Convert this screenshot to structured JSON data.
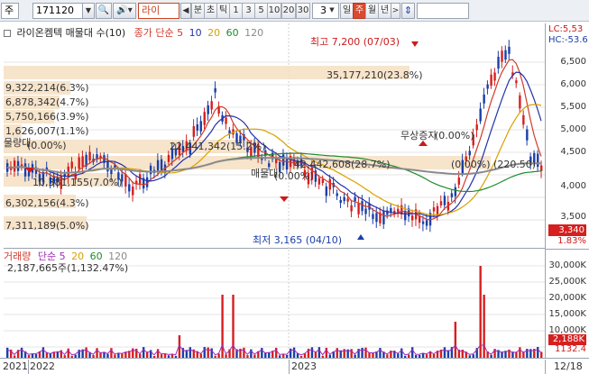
{
  "toolbar": {
    "market_code": "주",
    "stock_code": "171120",
    "stock_name": "라이",
    "period_tabs": [
      "분",
      "초",
      "틱",
      "1",
      "3",
      "5",
      "10",
      "20",
      "30"
    ],
    "period_value": "3",
    "range_tabs": [
      "일",
      "주",
      "월",
      "년"
    ],
    "active_range": "주"
  },
  "panel": {
    "title": "라이온켐텍 매물대 수(10)",
    "ma_label": "종가 단순",
    "ma_periods": [
      "5",
      "10",
      "20",
      "60",
      "120"
    ],
    "ma_colors": [
      "#d03b2c",
      "#2233aa",
      "#d9a100",
      "#1f8c2e",
      "#8a8a8a"
    ],
    "high_label": "최고 7,200 (07/03)",
    "low_label": "최저 3,165 (04/10)",
    "lc_label": "LC:5,53",
    "hc_label": "HC:-53.6",
    "current_price": "3,340",
    "change_pct": "1.83%"
  },
  "profile_labels": {
    "l1": "9,322,214(6.3%)",
    "l2": "6,878,342(4.7%)",
    "l3": "5,750,166(3.9%)",
    "l4": "1,626,007(1.1%)",
    "l5": "22,441,342(15.2%)",
    "l6": "35,177,210(23.8%)",
    "l7": "42,442,608(28.7%)",
    "l8": "6,302,156(4.3%)",
    "l9": "7,311,189(5.0%)",
    "l10": "10,381,155(7.0%)",
    "l11": "물량대",
    "l12": "(0.00%)",
    "l13": "매물대",
    "l14": "(0.00%)",
    "l15": "(0.00%) (220.50)",
    "l16": "무상증자",
    "l17": "(0.00%)"
  },
  "price_axis": [
    "6,500",
    "6,000",
    "5,500",
    "5,000",
    "4,500",
    "4,000",
    "3,500"
  ],
  "volume": {
    "title": "거래량",
    "ma_label": "단순",
    "ma_periods": [
      "5",
      "20",
      "60",
      "120"
    ],
    "summary": "2,187,665주(1,132.47%)",
    "axis": [
      "30,000K",
      "25,000K",
      "20,000K",
      "15,000K",
      "10,000K",
      "5,000K"
    ],
    "current": "2,188K",
    "current_pct": "1132.4"
  },
  "x_axis": {
    "labels": [
      "2021",
      "2022",
      "2023",
      "12/18"
    ]
  },
  "colors": {
    "up": "#d61f1f",
    "down": "#1a3fa8",
    "band": "#f5dfc2",
    "accent": "#d9492f"
  }
}
